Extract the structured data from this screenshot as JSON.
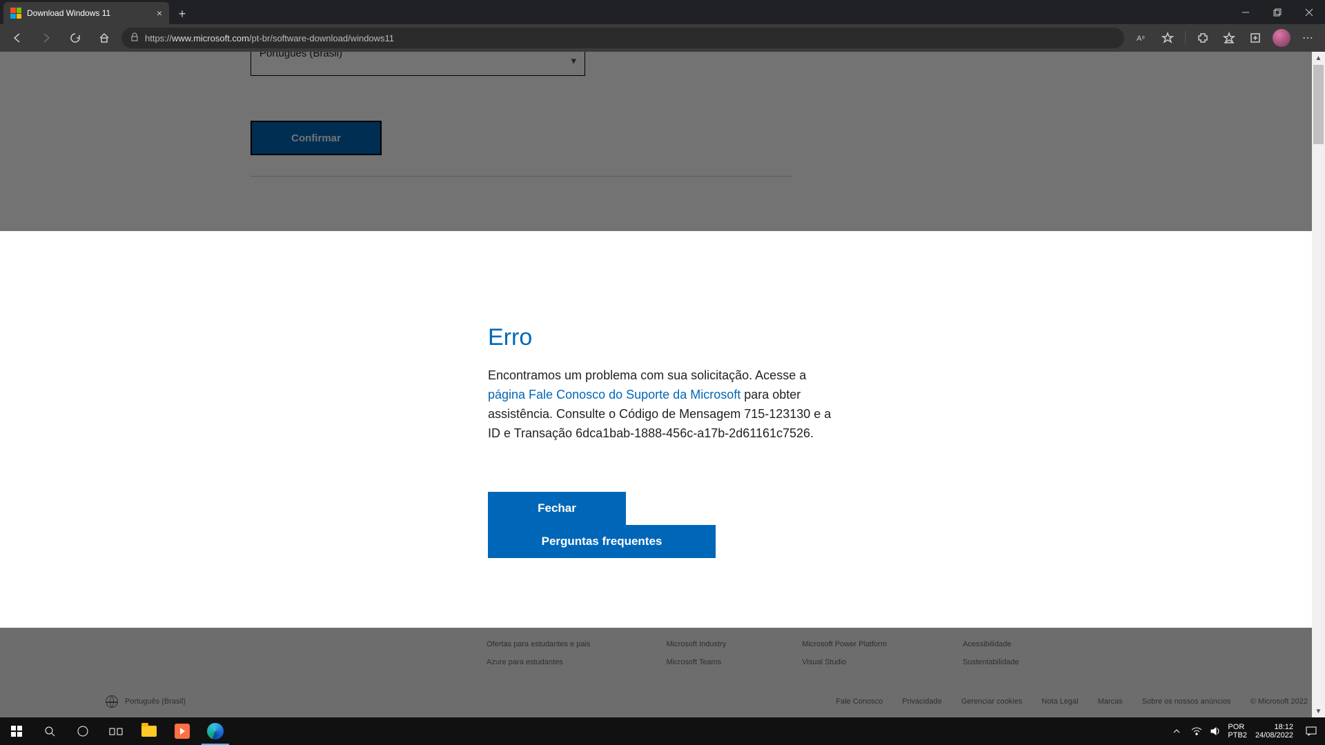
{
  "browser": {
    "tab_title": "Download Windows 11",
    "url_host": "www.microsoft.com",
    "url_path": "/pt-br/software-download/windows11",
    "url_scheme": "https://"
  },
  "form": {
    "language_selected": "Português (Brasil)",
    "confirm_label": "Confirmar"
  },
  "error": {
    "title": "Erro",
    "text1": "Encontramos um problema com sua solicitação. Acesse a ",
    "link": "página Fale Conosco do Suporte da Microsoft",
    "text2": " para obter assistência. Consulte o Código de Mensagem 715-123130 e a ID e Transação 6dca1bab-1888-456c-a17b-2d61161c7526.",
    "close_label": "Fechar",
    "faq_label": "Perguntas frequentes"
  },
  "footer": {
    "col1": [
      "Ofertas para estudantes e pais",
      "Azure para estudantes"
    ],
    "col2": [
      "Microsoft Industry",
      "Microsoft Teams"
    ],
    "col3": [
      "Microsoft Power Platform",
      "Visual Studio"
    ],
    "col4": [
      "Acessibilidade",
      "Sustentabilidade"
    ],
    "lang_label": "Português (Brasil)",
    "links": [
      "Fale Conosco",
      "Privacidade",
      "Gerenciar cookies",
      "Nota Legal",
      "Marcas",
      "Sobre os nossos anúncios",
      "© Microsoft 2022"
    ]
  },
  "taskbar": {
    "lang_code": "POR",
    "kb_layout": "PTB2",
    "time": "18:12",
    "date": "24/08/2022"
  }
}
